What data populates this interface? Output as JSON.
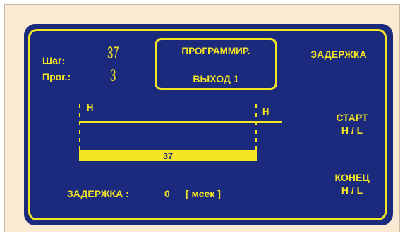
{
  "left_info": {
    "step_label": "Шаг:",
    "step_value": "37",
    "prog_label": "Прог.:",
    "prog_value": "3"
  },
  "mode_box": {
    "title": "ПРОГРАММИР.",
    "output": "ВЫХОД 1"
  },
  "right_menu": {
    "delay": "ЗАДЕРЖКА",
    "start_line1": "СТАРТ",
    "start_line2": "H / L",
    "end_line1": "КОНЕЦ",
    "end_line2": "H / L"
  },
  "timeline": {
    "start_level": "H",
    "end_level": "H",
    "bar_value": "37"
  },
  "footer": {
    "delay_label": "ЗАДЕРЖКА :",
    "delay_value": "0",
    "delay_unit": "[ мсек ]"
  },
  "colors": {
    "panel": "#1c2a7d",
    "accent": "#f5e624",
    "background": "#fbe9d3"
  }
}
